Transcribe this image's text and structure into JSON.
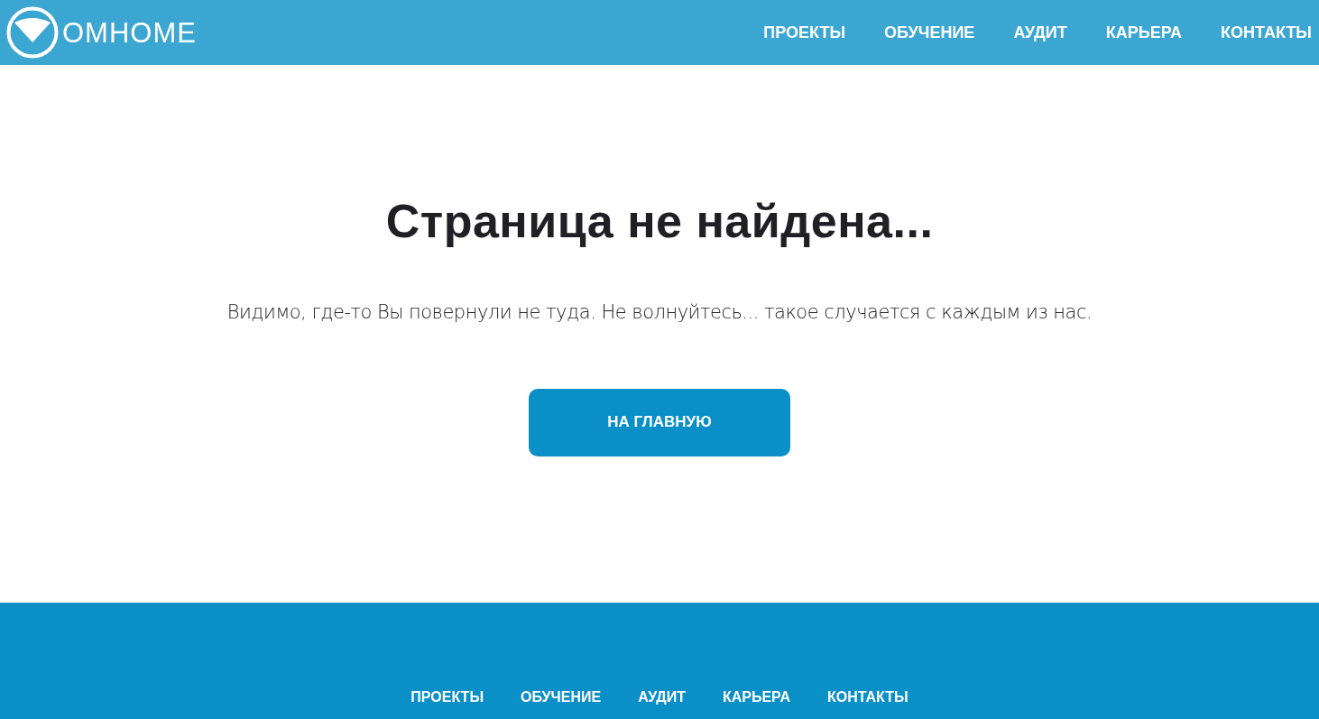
{
  "header": {
    "logo_text": "OMHOME",
    "nav": [
      {
        "label": "ПРОЕКТЫ"
      },
      {
        "label": "ОБУЧЕНИЕ"
      },
      {
        "label": "АУДИТ"
      },
      {
        "label": "КАРЬЕРА"
      },
      {
        "label": "КОНТАКТЫ"
      }
    ]
  },
  "main": {
    "title": "Страница не найдена...",
    "message": "Видимо, где-то Вы повернули не туда. Не волнуйтесь... такое случается с каждым из нас.",
    "button": "НА ГЛАВНУЮ"
  },
  "footer": {
    "nav": [
      {
        "label": "ПРОЕКТЫ"
      },
      {
        "label": "ОБУЧЕНИЕ"
      },
      {
        "label": "АУДИТ"
      },
      {
        "label": "КАРЬЕРА"
      },
      {
        "label": "КОНТАКТЫ"
      }
    ]
  }
}
